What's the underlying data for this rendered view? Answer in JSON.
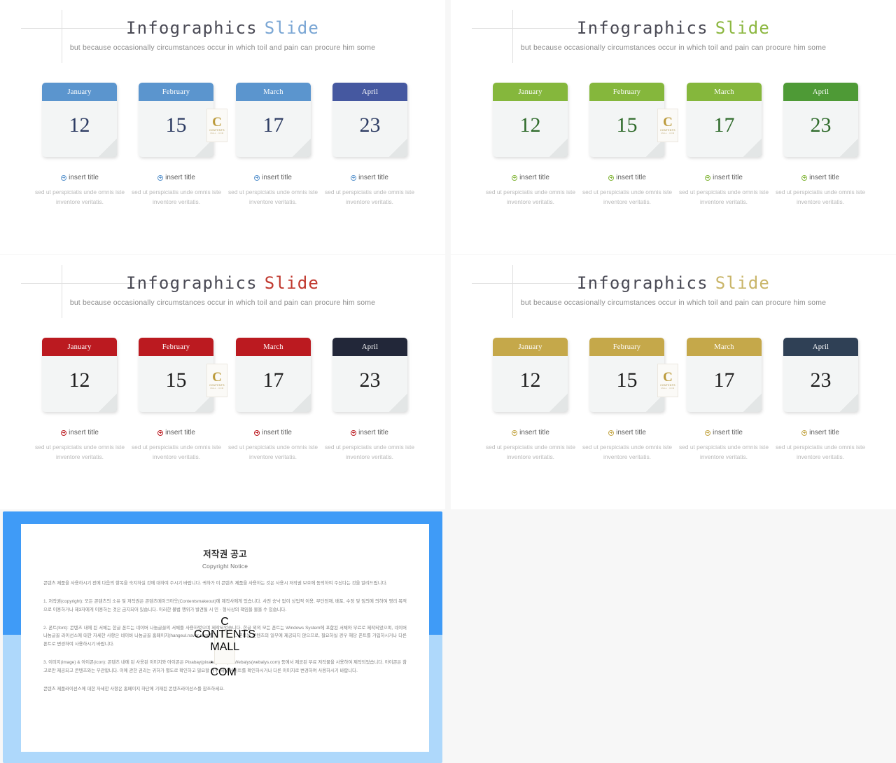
{
  "slides": [
    {
      "id": "slide-blue",
      "title_primary": "Infographics",
      "title_accent": "Slide",
      "accent_color": "#7aa6d4",
      "subtitle": "but because occasionally circumstances occur in which toil and pain can procure him some",
      "cards": [
        {
          "month": "January",
          "day": "12",
          "header_color": "#5b95ce",
          "num_color": "#2d3c63"
        },
        {
          "month": "February",
          "day": "15",
          "header_color": "#5b95ce",
          "num_color": "#2d3c63"
        },
        {
          "month": "March",
          "day": "17",
          "header_color": "#5b95ce",
          "num_color": "#2d3c63"
        },
        {
          "month": "April",
          "day": "23",
          "header_color": "#4558a0",
          "num_color": "#2d3c63"
        }
      ],
      "captions": [
        {
          "title": "insert title",
          "body": "sed ut perspiciatis unde omnis iste inventore veritatis.",
          "icon_color": "#5b95ce"
        },
        {
          "title": "insert title",
          "body": "sed ut perspiciatis unde omnis iste inventore veritatis.",
          "icon_color": "#5b95ce"
        },
        {
          "title": "insert title",
          "body": "sed ut perspiciatis unde omnis iste inventore veritatis.",
          "icon_color": "#5b95ce"
        },
        {
          "title": "insert title",
          "body": "sed ut perspiciatis unde omnis iste inventore veritatis.",
          "icon_color": "#5b95ce"
        }
      ]
    },
    {
      "id": "slide-green",
      "title_primary": "Infographics",
      "title_accent": "Slide",
      "accent_color": "#8cb740",
      "subtitle": "but because occasionally circumstances occur in which toil and pain can procure him some",
      "cards": [
        {
          "month": "January",
          "day": "12",
          "header_color": "#85b73c",
          "num_color": "#2f6b2b"
        },
        {
          "month": "February",
          "day": "15",
          "header_color": "#85b73c",
          "num_color": "#2f6b2b"
        },
        {
          "month": "March",
          "day": "17",
          "header_color": "#85b73c",
          "num_color": "#2f6b2b"
        },
        {
          "month": "April",
          "day": "23",
          "header_color": "#4e9a36",
          "num_color": "#2f6b2b"
        }
      ],
      "captions": [
        {
          "title": "insert title",
          "body": "sed ut perspiciatis unde omnis iste inventore veritatis.",
          "icon_color": "#85b73c"
        },
        {
          "title": "insert title",
          "body": "sed ut perspiciatis unde omnis iste inventore veritatis.",
          "icon_color": "#85b73c"
        },
        {
          "title": "insert title",
          "body": "sed ut perspiciatis unde omnis iste inventore veritatis.",
          "icon_color": "#85b73c"
        },
        {
          "title": "insert title",
          "body": "sed ut perspiciatis unde omnis iste inventore veritatis.",
          "icon_color": "#85b73c"
        }
      ]
    },
    {
      "id": "slide-red",
      "title_primary": "Infographics",
      "title_accent": "Slide",
      "accent_color": "#c0392f",
      "subtitle": "but because occasionally circumstances occur in which toil and pain can procure him some",
      "cards": [
        {
          "month": "January",
          "day": "12",
          "header_color": "#bb1a20",
          "num_color": "#1d1d1d"
        },
        {
          "month": "February",
          "day": "15",
          "header_color": "#bb1a20",
          "num_color": "#1d1d1d"
        },
        {
          "month": "March",
          "day": "17",
          "header_color": "#bb1a20",
          "num_color": "#1d1d1d"
        },
        {
          "month": "April",
          "day": "23",
          "header_color": "#222739",
          "num_color": "#1d1d1d"
        }
      ],
      "captions": [
        {
          "title": "insert title",
          "body": "sed ut perspiciatis unde omnis iste inventore veritatis.",
          "icon_color": "#bb1a20"
        },
        {
          "title": "insert title",
          "body": "sed ut perspiciatis unde omnis iste inventore veritatis.",
          "icon_color": "#bb1a20"
        },
        {
          "title": "insert title",
          "body": "sed ut perspiciatis unde omnis iste inventore veritatis.",
          "icon_color": "#bb1a20"
        },
        {
          "title": "insert title",
          "body": "sed ut perspiciatis unde omnis iste inventore veritatis.",
          "icon_color": "#bb1a20"
        }
      ]
    },
    {
      "id": "slide-gold",
      "title_primary": "Infographics",
      "title_accent": "Slide",
      "accent_color": "#c9b569",
      "subtitle": "but because occasionally circumstances occur in which toil and pain can procure him some",
      "cards": [
        {
          "month": "January",
          "day": "12",
          "header_color": "#c5a84a",
          "num_color": "#1d1d1d"
        },
        {
          "month": "February",
          "day": "15",
          "header_color": "#c5a84a",
          "num_color": "#1d1d1d"
        },
        {
          "month": "March",
          "day": "17",
          "header_color": "#c5a84a",
          "num_color": "#1d1d1d"
        },
        {
          "month": "April",
          "day": "23",
          "header_color": "#2f4055",
          "num_color": "#1d1d1d"
        }
      ],
      "captions": [
        {
          "title": "insert title",
          "body": "sed ut perspiciatis unde omnis iste inventore veritatis.",
          "icon_color": "#c5a84a"
        },
        {
          "title": "insert title",
          "body": "sed ut perspiciatis unde omnis iste inventore veritatis.",
          "icon_color": "#c5a84a"
        },
        {
          "title": "insert title",
          "body": "sed ut perspiciatis unde omnis iste inventore veritatis.",
          "icon_color": "#c5a84a"
        },
        {
          "title": "insert title",
          "body": "sed ut perspiciatis unde omnis iste inventore veritatis.",
          "icon_color": "#c5a84a"
        }
      ]
    }
  ],
  "watermark": {
    "letter": "C",
    "line1": "CONTENTS",
    "line2": "MALL . COM"
  },
  "copyright_panel": {
    "frame_color_top": "#3f9bf7",
    "frame_color_bottom": "#aed8fb",
    "heading_ko": "저작권 공고",
    "heading_en": "Copyright Notice",
    "paragraphs": [
      "콘텐츠 제품을 사용하시기 전에 다음의 항목을 숙지하실 것에 대하여 주시기 바랍니다. 귀하가 이 콘텐츠 제품을 사용하는 것은 사용시 저작권 보호에 동의하여 주신다는 것을 알려드립니다.",
      "1. 저작권(copyright): 모든 콘텐츠의 소유 및 저작권은 콘텐츠메이크아웃(Contentsmakeout)에 제작사에게 있습니다. 사전 승낙 없이 상업적 이용, 무단전재, 배포, 수정 및 임의에 의하여 영리 목적으로 이용하거나 제3자에게 이용하는 것은 금지되어 있습니다. 이러한 불법 행위가 발견될 시 민ㆍ형사상의 책임을 물을 수 있습니다.",
      "2. 폰트(font): 콘텐츠 내에 된 서체는 한글 폰트는 네이버 나눔글꼴의 서체를 사용하였으며 제작되었습니다. 한글 외의 모든 폰트는 Windows System에 포함된 서체와 무료로 제작되었으며, 네이버 나눔글꼴 라이선스에 대한 자세한 사항은 네이버 나눔글꼴 홈페이지(hangeul.naver.com)를 참조하세요. 폰트는 콘텐츠의 일부에 제공되지 않으므로, 필요하실 경우 해당 폰트를 가입하시거나 다른 폰트로 변경하여 사용하시기 바랍니다.",
      "3. 이미지(image) & 아이콘(icon): 콘텐츠 내에 된 사용된 이미지와 아이콘은 Pixabay(pixabay.com)와 Webalys(webalys.com) 등에서 제공된 무료 저작물을 사용하여 제작되었습니다. 아이콘은 참고로만 제공되고 콘텐츠와는 무관합니다. 이에 관한 권리는 귀하가 별도로 확인하고 필요할 경우 해당 사이트를 확인하시거나 다른 이미지로 변경하여 사용하시기 바랍니다.",
      "콘텐츠 제품라이선스에 대한 자세한 사항은 홈페이지 하단에 기재된 콘텐츠라이선스를 참조하세요."
    ]
  }
}
